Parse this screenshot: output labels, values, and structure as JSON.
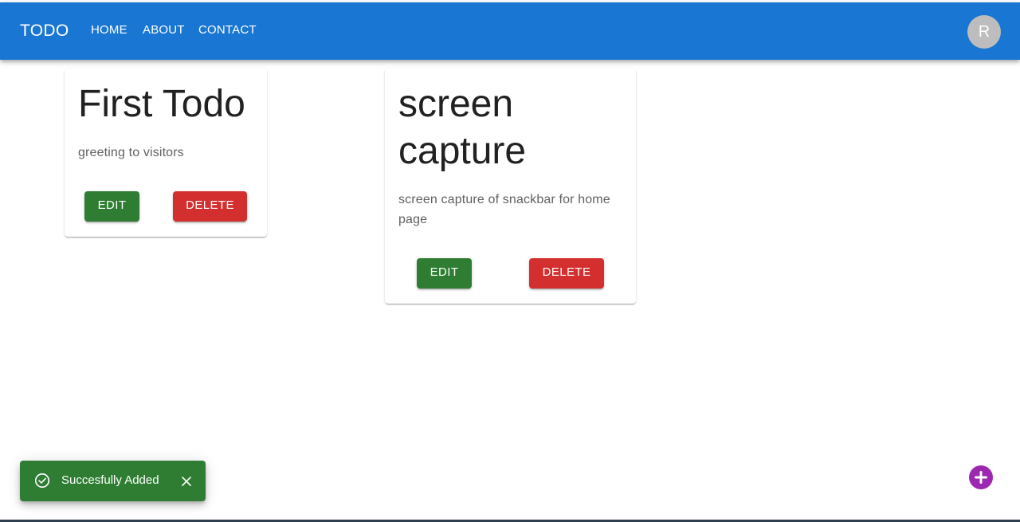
{
  "app": {
    "brand": "TODO",
    "nav": [
      {
        "label": "HOME"
      },
      {
        "label": "ABOUT"
      },
      {
        "label": "CONTACT"
      }
    ],
    "avatar_initial": "R"
  },
  "todos": [
    {
      "title": "First Todo",
      "description": "greeting to visitors",
      "edit_label": "EDIT",
      "delete_label": "DELETE"
    },
    {
      "title": "screen capture",
      "description": "screen capture of snackbar for home page",
      "edit_label": "EDIT",
      "delete_label": "DELETE"
    }
  ],
  "snackbar": {
    "message": "Succesfully Added",
    "icon": "check-circle-icon",
    "close_icon": "close-icon",
    "color": "#2e7d32"
  },
  "fab": {
    "icon": "add-icon",
    "color": "#9c27b0"
  },
  "colors": {
    "appbar": "#1976d2",
    "edit": "#2e7d32",
    "delete": "#d32f2f",
    "avatar": "#bdbdbd"
  }
}
